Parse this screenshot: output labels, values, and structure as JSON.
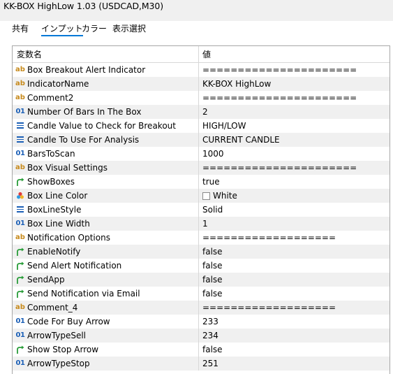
{
  "window": {
    "title": "KK-BOX HighLow 1.03 (USDCAD,M30)"
  },
  "tabs": [
    "共有",
    "インプット",
    "カラー",
    "表示選択"
  ],
  "active_tab": 1,
  "grid": {
    "headers": {
      "name": "変数名",
      "value": "値"
    },
    "rows": [
      {
        "icon": "ab-icon",
        "name": "Box Breakout Alert Indicator",
        "value": "======================"
      },
      {
        "icon": "ab-icon",
        "name": "IndicatorName",
        "value": "KK-BOX HighLow"
      },
      {
        "icon": "ab-icon",
        "name": "Comment2",
        "value": "======================"
      },
      {
        "icon": "num-icon",
        "name": "Number Of Bars In The Box",
        "value": "2"
      },
      {
        "icon": "enum-icon",
        "name": "Candle Value to Check for Breakout",
        "value": "HIGH/LOW"
      },
      {
        "icon": "enum-icon",
        "name": "Candle To Use For Analysis",
        "value": "CURRENT CANDLE"
      },
      {
        "icon": "num-icon",
        "name": "BarsToScan",
        "value": "1000"
      },
      {
        "icon": "ab-icon",
        "name": "Box Visual Settings",
        "value": "======================"
      },
      {
        "icon": "bool-icon",
        "name": "ShowBoxes",
        "value": "true"
      },
      {
        "icon": "color-icon",
        "name": "Box Line Color",
        "value": "White",
        "swatch": "#ffffff"
      },
      {
        "icon": "enum-icon",
        "name": "BoxLineStyle",
        "value": "Solid"
      },
      {
        "icon": "num-icon",
        "name": "Box Line Width",
        "value": "1"
      },
      {
        "icon": "ab-icon",
        "name": "Notification Options",
        "value": "==================="
      },
      {
        "icon": "bool-icon",
        "name": "EnableNotify",
        "value": "false"
      },
      {
        "icon": "bool-icon",
        "name": "Send Alert Notification",
        "value": "false"
      },
      {
        "icon": "bool-icon",
        "name": "SendApp",
        "value": "false"
      },
      {
        "icon": "bool-icon",
        "name": "Send Notification via Email",
        "value": "false"
      },
      {
        "icon": "ab-icon",
        "name": "Comment_4",
        "value": "==================="
      },
      {
        "icon": "num-icon",
        "name": "Code For Buy Arrow",
        "value": "233"
      },
      {
        "icon": "num-icon",
        "name": "ArrowTypeSell",
        "value": "234"
      },
      {
        "icon": "bool-icon",
        "name": "Show Stop Arrow",
        "value": "false"
      },
      {
        "icon": "num-icon",
        "name": "ArrowTypeStop",
        "value": "251"
      }
    ]
  },
  "icon_glyphs": {
    "ab-icon": "ab",
    "num-icon": "01"
  },
  "colors": {
    "accent": "#0078d7",
    "string_icon": "#c78a1c",
    "number_icon": "#1b5fb6",
    "bool_icon": "#2a9d3a",
    "grid_border": "#a7a7a7"
  }
}
